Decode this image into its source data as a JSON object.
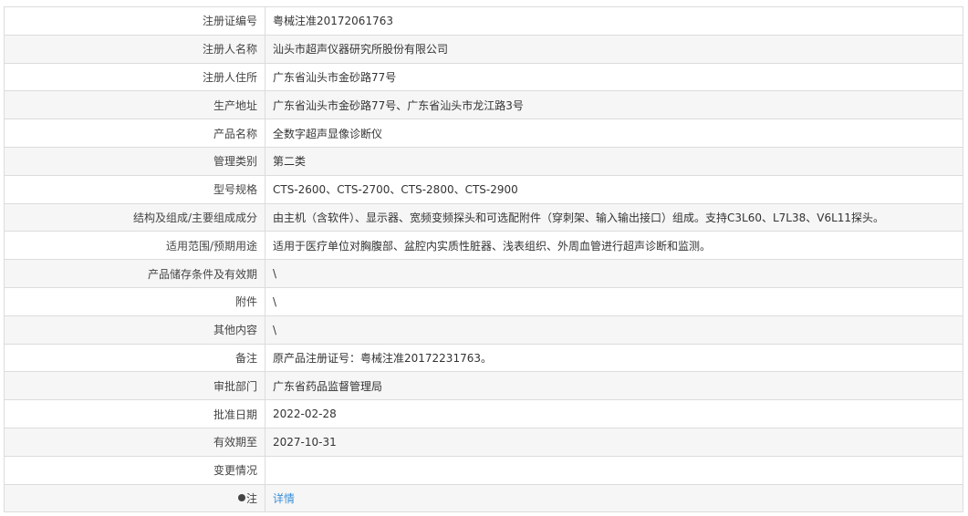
{
  "rows": [
    {
      "label": "注册证编号",
      "value": "粤械注准20172061763"
    },
    {
      "label": "注册人名称",
      "value": "汕头市超声仪器研究所股份有限公司"
    },
    {
      "label": "注册人住所",
      "value": "广东省汕头市金砂路77号"
    },
    {
      "label": "生产地址",
      "value": "广东省汕头市金砂路77号、广东省汕头市龙江路3号"
    },
    {
      "label": "产品名称",
      "value": "全数字超声显像诊断仪"
    },
    {
      "label": "管理类别",
      "value": "第二类"
    },
    {
      "label": "型号规格",
      "value": "CTS-2600、CTS-2700、CTS-2800、CTS-2900"
    },
    {
      "label": "结构及组成/主要组成成分",
      "value": "由主机（含软件）、显示器、宽频变频探头和可选配附件（穿刺架、输入输出接口）组成。支持C3L60、L7L38、V6L11探头。"
    },
    {
      "label": "适用范围/预期用途",
      "value": "适用于医疗单位对胸腹部、盆腔内实质性脏器、浅表组织、外周血管进行超声诊断和监测。"
    },
    {
      "label": "产品储存条件及有效期",
      "value": "\\"
    },
    {
      "label": "附件",
      "value": "\\"
    },
    {
      "label": "其他内容",
      "value": "\\"
    },
    {
      "label": "备注",
      "value": "原产品注册证号：粤械注准20172231763。"
    },
    {
      "label": "审批部门",
      "value": "广东省药品监督管理局"
    },
    {
      "label": "批准日期",
      "value": "2022-02-28"
    },
    {
      "label": "有效期至",
      "value": "2027-10-31"
    },
    {
      "label": "变更情况",
      "value": ""
    }
  ],
  "note": {
    "label": "注",
    "link": "详情",
    "icon": "pin-icon"
  }
}
